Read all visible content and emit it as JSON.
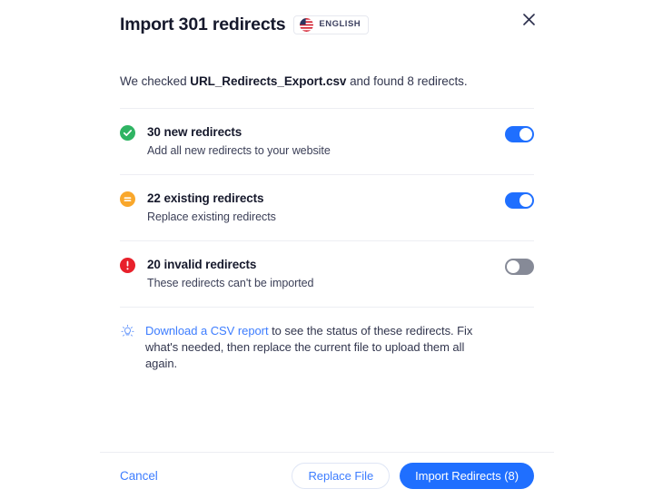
{
  "dialog": {
    "title": "Import 301 redirects",
    "language_badge": {
      "label": "ENGLISH",
      "flag": "us-flag-icon"
    },
    "close_label": "×",
    "summary": {
      "prefix": "We checked ",
      "filename": "URL_Redirects_Export.csv",
      "suffix": " and found 8 redirects."
    },
    "items": [
      {
        "icon": "check-circle-icon",
        "icon_color": "#2fb463",
        "title": "30 new redirects",
        "subtitle": "Add all new redirects to your website",
        "toggle_state": "on"
      },
      {
        "icon": "equals-circle-icon",
        "icon_color": "#f9a72b",
        "title": "22 existing redirects",
        "subtitle": "Replace existing redirects",
        "toggle_state": "on"
      },
      {
        "icon": "error-circle-icon",
        "icon_color": "#e8212b",
        "title": "20 invalid redirects",
        "subtitle": "These redirects can't be imported",
        "toggle_state": "off"
      }
    ],
    "tip": {
      "icon": "lightbulb-icon",
      "link_text": "Download a CSV report",
      "rest_text": " to see the status of these redirects. Fix what's needed, then replace the current file to upload them all again."
    },
    "footer": {
      "cancel_label": "Cancel",
      "replace_label": "Replace File",
      "import_label": "Import Redirects (8)"
    }
  },
  "colors": {
    "accent_blue": "#1f6fff",
    "link_blue": "#3d7dff",
    "success_green": "#2fb463",
    "warning_orange": "#f9a72b",
    "error_red": "#e8212b",
    "toggle_off_grey": "#868a97",
    "text_dark": "#16192c",
    "divider": "#edeef3"
  }
}
